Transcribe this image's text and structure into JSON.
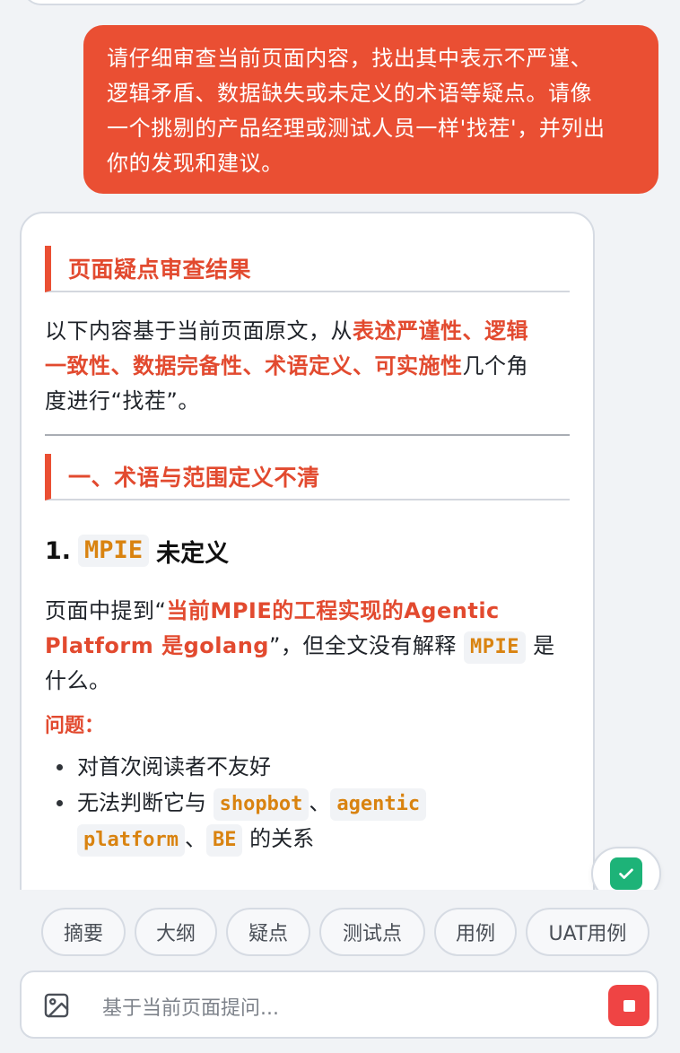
{
  "user_message": {
    "line1": "请仔细审查当前页面内容，找出其中表示不严谨、",
    "line2": "逻辑矛盾、数据缺失或未定义的术语等疑点。请像",
    "line3": "一个挑剔的产品经理或测试人员一样'找茬'，并列出",
    "line4": "你的发现和建议。"
  },
  "response": {
    "title": "页面疑点审查结果",
    "intro": {
      "l1_pre": "以下内容基于当前页面原文，从",
      "l1_hl": "表述严谨性、逻辑",
      "l2_hl": "一致性、数据完备性、术语定义、可实施性",
      "l2_post": "几个角",
      "l3": "度进行“找茬”。"
    },
    "section1": {
      "title": "一、术语与范围定义不清",
      "item1": {
        "num": "1.",
        "code": "MPIE",
        "suffix": "未定义",
        "p_pre": "页面中提到“",
        "p_hl1": "当前MPIE的工程实现的Agentic",
        "p_hl2": "Platform 是golang",
        "p_mid": "”，但全文没有解释",
        "p_code": "MPIE",
        "p_end": "是",
        "p_l3": "什么。",
        "issue_label": "问题：",
        "bullet1": "对首次阅读者不友好",
        "bullet2_pre": "无法判断它与",
        "bullet2_code1": "shopbot",
        "bullet2_sep1": "、",
        "bullet2_code2a": "agentic",
        "bullet2_code2b": "platform",
        "bullet2_sep2": "、",
        "bullet2_code3": "BE",
        "bullet2_post": "的关系"
      }
    }
  },
  "quick_actions": [
    "摘要",
    "大纲",
    "疑点",
    "测试点",
    "用例",
    "UAT用例"
  ],
  "input": {
    "placeholder": "基于当前页面提问..."
  },
  "icons": {
    "image": "image-icon",
    "stop": "stop-icon",
    "check": "check-icon"
  },
  "colors": {
    "accent": "#ea4f33",
    "code": "#d98310",
    "success": "#1db378",
    "stop": "#ef4444"
  }
}
